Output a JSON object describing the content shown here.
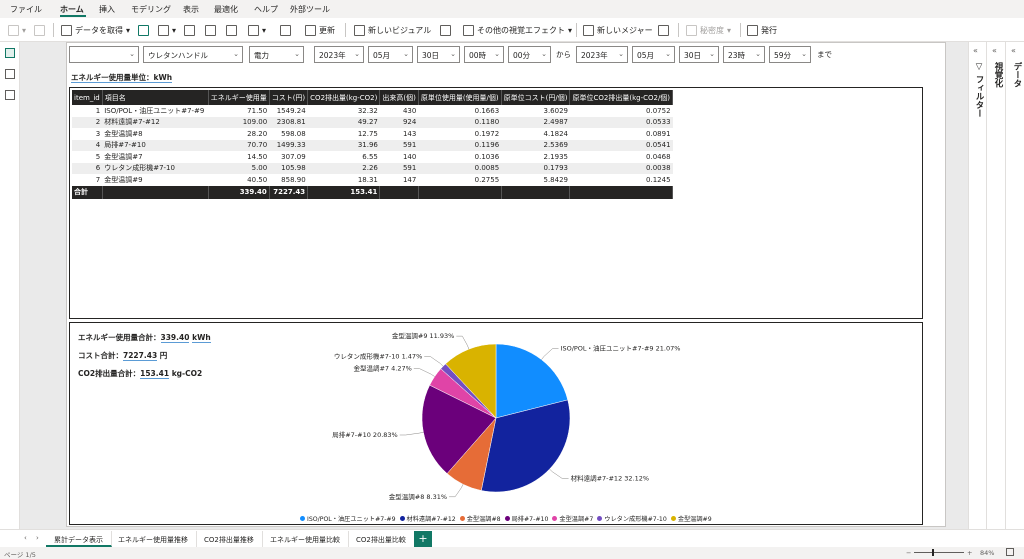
{
  "menu": [
    "ファイル",
    "ホーム",
    "挿入",
    "モデリング",
    "表示",
    "最適化",
    "ヘルプ",
    "外部ツール"
  ],
  "ribbon": {
    "get_data": "データを取得",
    "refresh": "更新",
    "new_visual": "新しいビジュアル",
    "more_visuals": "その他の視覚エフェクト",
    "new_measure": "新しいメジャー",
    "sensitivity": "秘密度",
    "publish": "発行"
  },
  "filters": {
    "machine": "ウレタンハンドル",
    "type": "電力",
    "from_year": "2023年",
    "from_month": "05月",
    "from_day": "30日",
    "from_hour": "00時",
    "from_minute": "00分",
    "from_label": "から",
    "to_year": "2023年",
    "to_month": "05月",
    "to_day": "30日",
    "to_hour": "23時",
    "to_minute": "59分",
    "to_label": "まで"
  },
  "unit_label": {
    "prefix": "エネルギー使用量単位：",
    "unit": "kWh"
  },
  "table": {
    "headers": [
      "item_id",
      "項目名",
      "エネルギー使用量",
      "コスト(円)",
      "CO2排出量(kg-CO2)",
      "出来高(個)",
      "原単位使用量(使用量/個)",
      "原単位コスト(円/個)",
      "原単位CO2排出量(kg-CO2/個)"
    ],
    "rows": [
      [
        "1",
        "ISO/POL・油圧ユニット#7-#9",
        "71.50",
        "1549.24",
        "32.32",
        "430",
        "0.1663",
        "3.6029",
        "0.0752"
      ],
      [
        "2",
        "材料遠調#7-#12",
        "109.00",
        "2308.81",
        "49.27",
        "924",
        "0.1180",
        "2.4987",
        "0.0533"
      ],
      [
        "3",
        "金型温調#8",
        "28.20",
        "598.08",
        "12.75",
        "143",
        "0.1972",
        "4.1824",
        "0.0891"
      ],
      [
        "4",
        "局排#7-#10",
        "70.70",
        "1499.33",
        "31.96",
        "591",
        "0.1196",
        "2.5369",
        "0.0541"
      ],
      [
        "5",
        "金型温調#7",
        "14.50",
        "307.09",
        "6.55",
        "140",
        "0.1036",
        "2.1935",
        "0.0468"
      ],
      [
        "6",
        "ウレタン成形機#7-10",
        "5.00",
        "105.98",
        "2.26",
        "591",
        "0.0085",
        "0.1793",
        "0.0038"
      ],
      [
        "7",
        "金型温調#9",
        "40.50",
        "858.90",
        "18.31",
        "147",
        "0.2755",
        "5.8429",
        "0.1245"
      ]
    ],
    "total": {
      "label": "合計",
      "energy": "339.40",
      "cost": "7227.43",
      "co2": "153.41"
    }
  },
  "summary": {
    "energy_label": "エネルギー使用量合計：",
    "energy_value": "339.40",
    "energy_unit": "kWh",
    "cost_label": "コスト合計：",
    "cost_value": "7227.43",
    "cost_unit": "円",
    "co2_label": "CO2排出量合計：",
    "co2_value": "153.41",
    "co2_unit": "kg-CO2"
  },
  "chart_data": {
    "type": "pie",
    "categories": [
      "ISO/POL・油圧ユニット#7-#9",
      "材料遠調#7-#12",
      "金型温調#8",
      "局排#7-#10",
      "金型温調#7",
      "ウレタン成形機#7-10",
      "金型温調#9"
    ],
    "values": [
      71.5,
      109.0,
      28.2,
      70.7,
      14.5,
      5.0,
      40.5
    ],
    "percent_labels": [
      "21.07%",
      "32.12%",
      "8.31%",
      "20.83%",
      "4.27%",
      "1.47%",
      "11.93%"
    ],
    "colors": [
      "#118dff",
      "#12239e",
      "#e66c37",
      "#6b007b",
      "#e044a7",
      "#744ec2",
      "#d9b300"
    ],
    "legend_position": "bottom"
  },
  "tabs": [
    "累計データ表示",
    "エネルギー使用量推移",
    "CO2排出量推移",
    "エネルギー使用量比較",
    "CO2排出量比較"
  ],
  "right_panes": {
    "data": "データ",
    "visualize": "視覚化",
    "filter": "フィルター"
  },
  "status": {
    "page": "ページ 1/5",
    "zoom": "84%"
  }
}
